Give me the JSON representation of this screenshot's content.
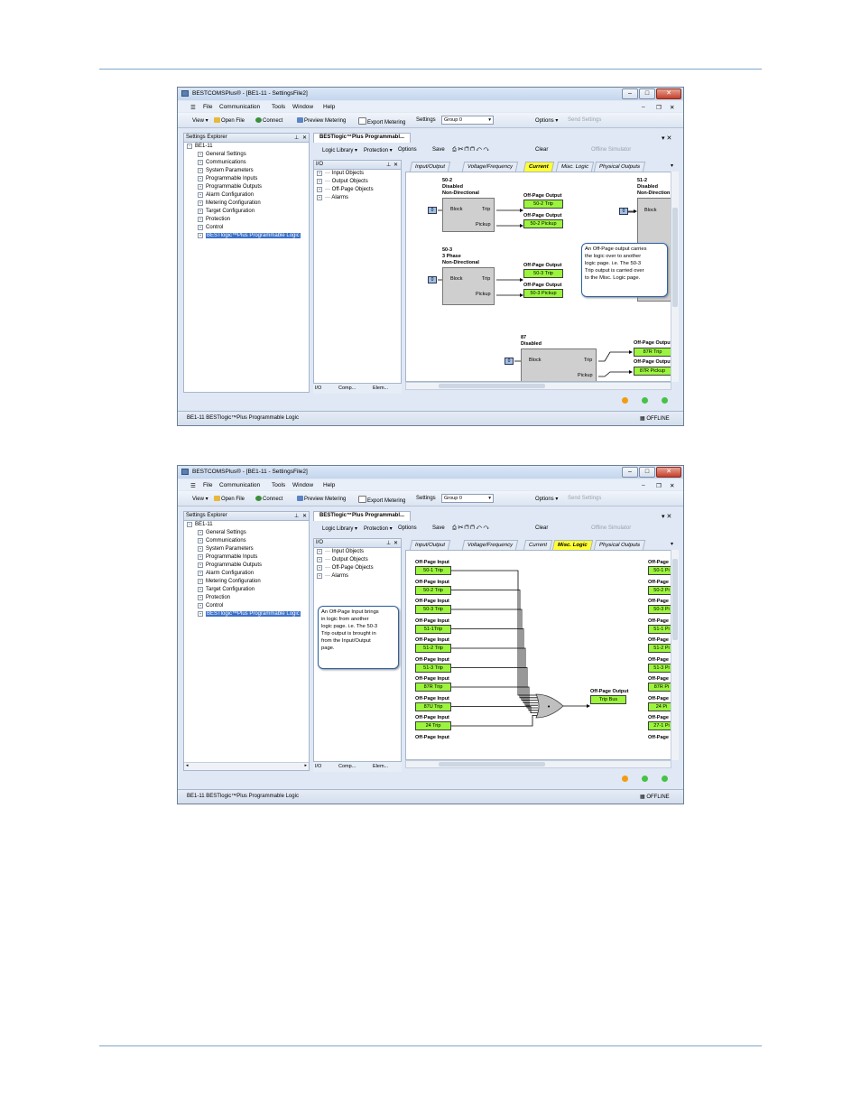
{
  "app": {
    "title": "BESTCOMSPlus® - [BE1-11 - SettingsFile2]",
    "menu": [
      "File",
      "Communication",
      "Tools",
      "Window",
      "Help"
    ],
    "toolbar": {
      "view": "View ▾",
      "open_file": "Open File",
      "connect": "Connect",
      "preview_metering": "Preview Metering",
      "export_metering": "Export Metering",
      "settings_label": "Settings",
      "settings_value": "Group 0",
      "options": "Options ▾",
      "send_settings": "Send Settings"
    },
    "explorer": {
      "title": "Settings Explorer",
      "root": "BE1-11",
      "items": [
        "General Settings",
        "Communications",
        "System Parameters",
        "Programmable Inputs",
        "Programmable Outputs",
        "Alarm Configuration",
        "Metering Configuration",
        "Target Configuration",
        "Protection",
        "Control",
        "BESTlogic™Plus Programmable Logic"
      ]
    },
    "doc_tab": "BESTlogic™Plus Programmabl...",
    "logic_toolbar": {
      "library": "Logic Library ▾",
      "protection": "Protection ▾",
      "options": "Options",
      "save": "Save",
      "clear": "Clear",
      "offline_sim": "Offline Simulator"
    },
    "io": {
      "title": "I/O",
      "items": [
        "Input Objects",
        "Output Objects",
        "Off-Page Objects",
        "Alarms"
      ],
      "bottom_tabs": [
        "I/O",
        "Comp...",
        "Elem..."
      ]
    },
    "logic_tabs": [
      "Input/Output",
      "Voltage/Frequency",
      "Current",
      "Misc. Logic",
      "Physical Outputs"
    ],
    "status": {
      "left": "BE1-11 BESTlogic™Plus Programmable Logic",
      "right": "OFFLINE"
    }
  },
  "shot1": {
    "active_tab": "Current",
    "blocks": [
      {
        "header": [
          "50-2",
          "Disabled",
          "Non-Directional"
        ],
        "block": "Block",
        "trip": "Trip",
        "pickup": "Pickup",
        "input": "0"
      },
      {
        "header": [
          "50-3",
          "3 Phase",
          "Non-Directional"
        ],
        "block": "Block",
        "trip": "Trip",
        "pickup": "Pickup",
        "input": "0"
      },
      {
        "header": [
          "51-2",
          "Disabled",
          "Non-Direction"
        ],
        "block": "Block",
        "input": "0"
      },
      {
        "header": [
          "87",
          "Disabled"
        ],
        "block": "Block",
        "trip": "Trip",
        "pickup": "Pickup",
        "input": "0"
      }
    ],
    "off_page_label": "Off-Page Output",
    "outputs": [
      "50-2 Trip",
      "50-2 Pickup",
      "50-3 Trip",
      "50-3 Pickup",
      "87R Trip",
      "87R Pickup"
    ],
    "callout": [
      "An Off-Page output carries",
      "the logic over to another",
      "logic page. i.e. The 50-3",
      "Trip output is carried over",
      "to the Misc. Logic page."
    ]
  },
  "shot2": {
    "active_tab": "Misc. Logic",
    "off_page_input_label": "Off-Page Input",
    "inputs": [
      "50-1 Trip",
      "50-2 Trip",
      "50-3 Trip",
      "51-1Trip",
      "51-2 Trip",
      "51-3 Trip",
      "87R Trip",
      "87U Trip",
      "24 Trip"
    ],
    "or_symbol": "•",
    "output_label": "Off-Page Output",
    "output": "Trip Bus",
    "right_label": "Off-Page",
    "right_outputs": [
      "50-1 Pi",
      "50-2 Pi",
      "50-3 Pi",
      "51-1 Pi",
      "51-2 Pi",
      "51-3 Pi",
      "87R Pi",
      "24 Pi",
      "27-1 Pi"
    ],
    "right_last": "Off-Page",
    "callout": [
      "An Off-Page Input brings",
      "in logic from another",
      "logic page. i.e. The 50-3",
      "Trip output is brought in",
      "from the Input/Output",
      "page."
    ]
  },
  "colors": {
    "highlight": "#ffff33",
    "io_box": "#9bf53d",
    "selection": "#3a70c8"
  }
}
